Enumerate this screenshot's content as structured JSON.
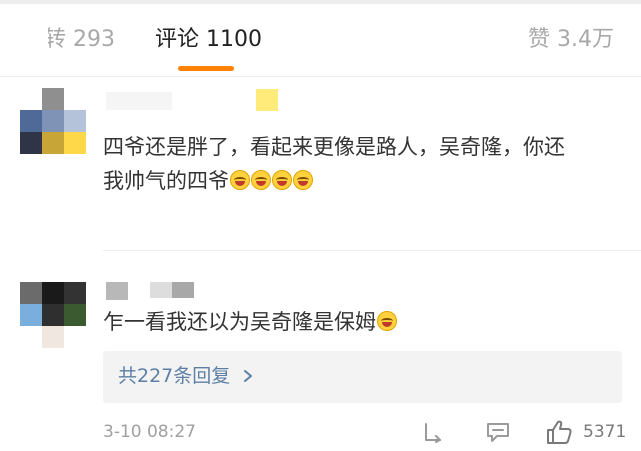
{
  "tabs": {
    "repost_label": "转",
    "repost_count": "293",
    "comments_label": "评论",
    "comments_count": "1100",
    "likes_label": "赞",
    "likes_count": "3.4万",
    "accent_color": "#ff8200"
  },
  "comments": [
    {
      "text": "四爷还是胖了，看起来更像是路人，吴奇隆，你还",
      "text_line2": "我帅气的四爷",
      "emoji_icon": "laughing-tears-emoji",
      "emoji_count": 4
    },
    {
      "text": "乍一看我还以为吴奇隆是保姆",
      "emoji_icon": "laughing-tears-emoji",
      "emoji_count": 1,
      "replies_link": "共227条回复",
      "time": "3-10 08:27",
      "likes": "5371"
    }
  ],
  "icons": {
    "reply": "reply-icon",
    "comment": "comment-icon",
    "like": "thumbs-up-icon",
    "chevron": "chevron-right-icon"
  }
}
